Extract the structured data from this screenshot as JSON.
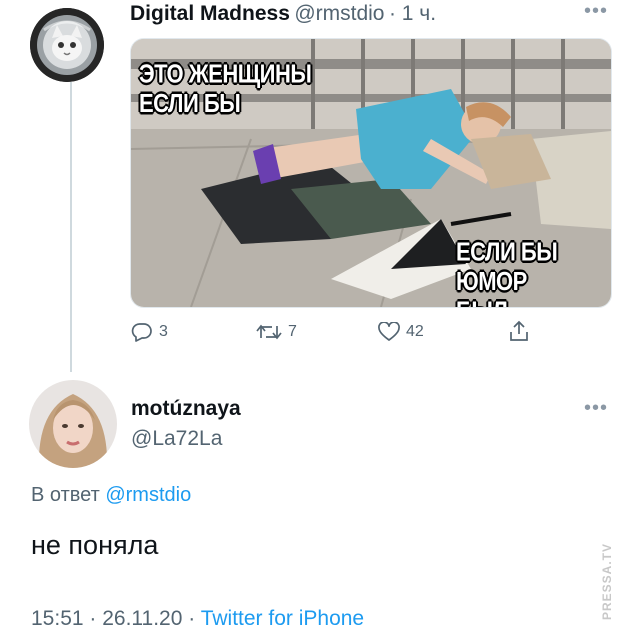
{
  "tweet": {
    "author_name": "Digital Madness",
    "author_handle": "@rmstdio",
    "time": "· 1 ч.",
    "meme": {
      "top_caption_line1": "ЭТО ЖЕНЩИНЫ",
      "top_caption_line2": "ЕСЛИ БЫ",
      "bottom_caption_line1": "ЕСЛИ БЫ ЮМОР",
      "bottom_caption_line2": "БЫЛ РАБОТОЙ"
    },
    "actions": {
      "replies": "3",
      "retweets": "7",
      "likes": "42"
    }
  },
  "reply": {
    "author_name": "motúznaya",
    "author_handle": "@La72La",
    "reply_to_prefix": "В ответ",
    "reply_to_handle": "@rmstdio",
    "text": "не поняла",
    "timestamp": "15:51 · 26.11.20 ·",
    "client": "Twitter for iPhone"
  },
  "watermark": "PRESSA.TV",
  "colors": {
    "link": "#1d9bf0",
    "secondary_text": "#536471",
    "thread_line": "#cfd9de"
  }
}
